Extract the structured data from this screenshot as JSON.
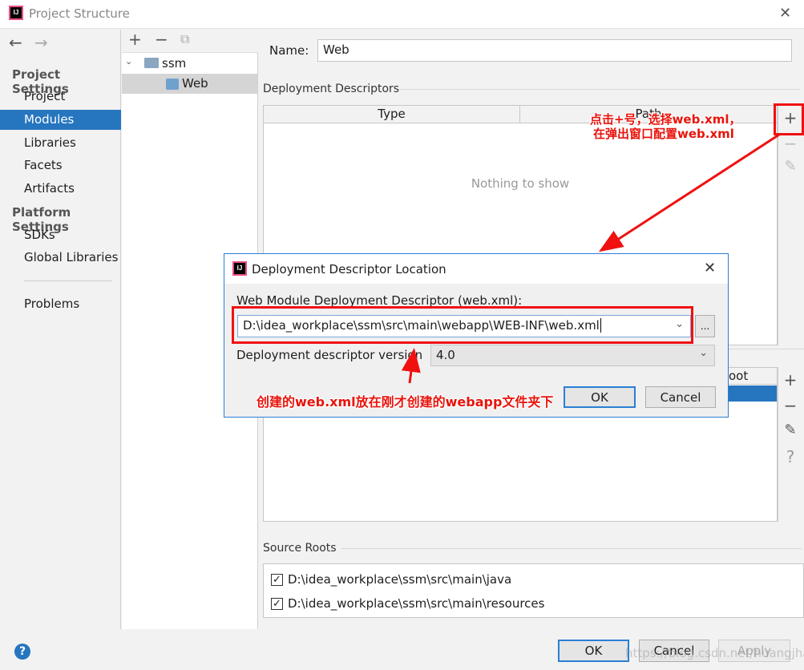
{
  "window": {
    "title": "Project Structure",
    "close": "✕",
    "help": "?"
  },
  "sidebar": {
    "back": "←",
    "forward": "→",
    "project_settings": "Project Settings",
    "items": [
      "Project",
      "Modules",
      "Libraries",
      "Facets",
      "Artifacts"
    ],
    "platform_settings": "Platform Settings",
    "platform_items": [
      "SDKs",
      "Global Libraries"
    ],
    "problems": "Problems",
    "selected": "Modules"
  },
  "tree": {
    "toolbar": {
      "add": "+",
      "remove": "−",
      "copy": "⧉"
    },
    "root": "ssm",
    "child": "Web"
  },
  "main": {
    "name_label": "Name:",
    "name_value": "Web",
    "deployment_descriptors": "Deployment Descriptors",
    "dd_columns": [
      "Type",
      "Path"
    ],
    "dd_empty": "Nothing to show",
    "toolbar": {
      "add": "+",
      "remove": "−",
      "edit": "✎",
      "help": "?"
    },
    "web_resource_column_partial": "oot",
    "source_roots": "Source Roots",
    "source_root_items": [
      "D:\\idea_workplace\\ssm\\src\\main\\java",
      "D:\\idea_workplace\\ssm\\src\\main\\resources"
    ]
  },
  "footer": {
    "ok": "OK",
    "cancel": "Cancel",
    "apply": "Apply"
  },
  "dialog": {
    "title": "Deployment Descriptor Location",
    "close": "✕",
    "path_label": "Web Module Deployment Descriptor (web.xml):",
    "path_value": "D:\\idea_workplace\\ssm\\src\\main\\webapp\\WEB-INF\\web.xml",
    "browse": "...",
    "version_label": "Deployment descriptor version",
    "version_value": "4.0",
    "ok": "OK",
    "cancel": "Cancel"
  },
  "annotations": {
    "plus_note_line1": "点击+号，选择web.xml，",
    "plus_note_line2": "在弹出窗口配置web.xml",
    "path_note": "创建的web.xml放在刚才创建的webapp文件夹下",
    "color": "#e8140c"
  },
  "watermark": "https://blog.csdn.net/huangjhai",
  "colors": {
    "selection": "#2675bf",
    "accent_border": "#2a7fd4"
  }
}
